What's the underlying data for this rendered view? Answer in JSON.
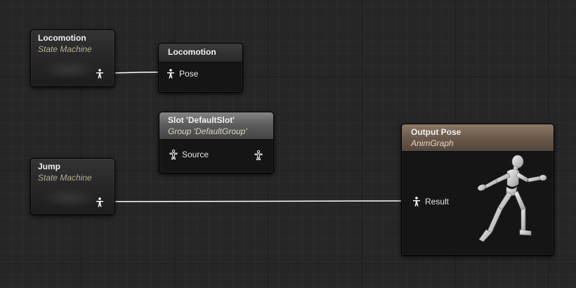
{
  "graph": {
    "name": "AnimGraph",
    "colors": {
      "background": "#262626",
      "wire": "#ffffff",
      "node_body": "#151515",
      "output_header": "#6b5a4c",
      "slot_header": "#5d5d5d"
    },
    "nodes": {
      "locomotion_sm": {
        "title": "Locomotion",
        "subtitle": "State Machine",
        "output_pin_icon": "pose-pin-icon"
      },
      "locomotion_ref": {
        "title": "Locomotion",
        "pin_label": "Pose"
      },
      "slot": {
        "title": "Slot 'DefaultSlot'",
        "subtitle": "Group 'DefaultGroup'",
        "pin_label": "Source",
        "input_connected": false,
        "output_connected": false
      },
      "jump_sm": {
        "title": "Jump",
        "subtitle": "State Machine",
        "output_pin_icon": "pose-pin-icon"
      },
      "output_pose": {
        "title": "Output Pose",
        "subtitle": "AnimGraph",
        "pin_label": "Result",
        "preview_icon": "running-mannequin-icon"
      }
    },
    "connections": [
      {
        "from": "Locomotion (State Machine)",
        "to": "Locomotion.Pose"
      },
      {
        "from": "Jump (State Machine)",
        "to": "Output Pose.Result"
      }
    ]
  }
}
